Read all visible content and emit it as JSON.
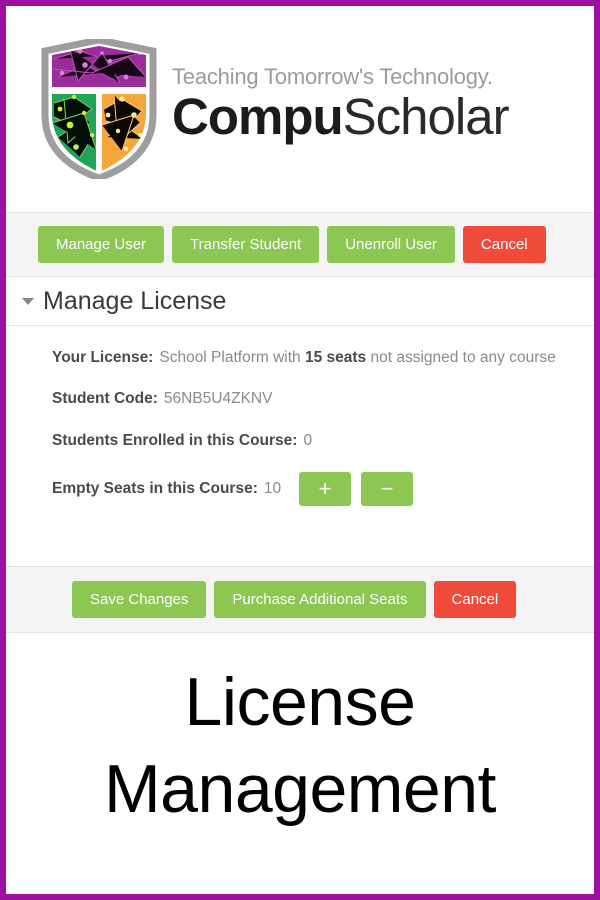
{
  "brand": {
    "tagline": "Teaching Tomorrow's Technology.",
    "name_bold": "Compu",
    "name_light": "Scholar",
    "shield_icon": "shield-logo-icon",
    "colors": {
      "purple": "#9C11A0",
      "shield_purple": "#9B2C9B",
      "shield_green": "#22A35A",
      "shield_orange": "#F5A73B",
      "shield_gray": "#9E9E9E",
      "green_button": "#8CC653",
      "red_button": "#F04A3B"
    }
  },
  "top_toolbar": {
    "buttons": [
      {
        "label": "Manage User",
        "style": "green"
      },
      {
        "label": "Transfer Student",
        "style": "green"
      },
      {
        "label": "Unenroll User",
        "style": "green"
      },
      {
        "label": "Cancel",
        "style": "red"
      }
    ]
  },
  "section": {
    "title": "Manage License",
    "caret_icon": "caret-down-icon",
    "expanded": true
  },
  "license": {
    "your_license_label": "Your License:",
    "your_license_prefix": "School Platform with",
    "your_license_seats": "15 seats",
    "your_license_suffix": "not assigned to any course",
    "student_code_label": "Student Code:",
    "student_code_value": "56NB5U4ZKNV",
    "students_enrolled_label": "Students Enrolled in this Course:",
    "students_enrolled_value": "0",
    "empty_seats_label": "Empty Seats in this Course:",
    "empty_seats_value": "10",
    "increment_label": "+",
    "decrement_label": "−",
    "increment_icon": "plus-icon",
    "decrement_icon": "minus-icon"
  },
  "footer_toolbar": {
    "buttons": [
      {
        "label": "Save Changes",
        "style": "green"
      },
      {
        "label": "Purchase Additional Seats",
        "style": "green"
      },
      {
        "label": "Cancel",
        "style": "red"
      }
    ]
  },
  "page_title": {
    "line1": "License",
    "line2": "Management"
  }
}
